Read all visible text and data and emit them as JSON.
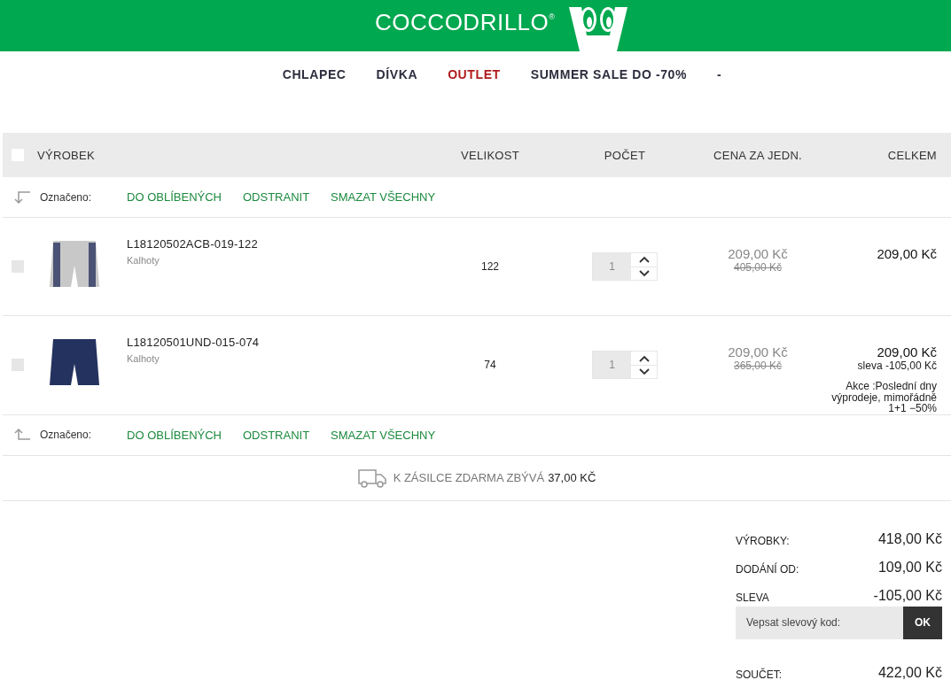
{
  "header": {
    "logo_text": "COCCODRILLO",
    "logo_mark": "®"
  },
  "nav": [
    {
      "label": "CHLAPEC",
      "highlighted": false
    },
    {
      "label": "DÍVKA",
      "highlighted": false
    },
    {
      "label": "OUTLET",
      "highlighted": true
    },
    {
      "label": "SUMMER SALE DO -70%",
      "highlighted": false
    },
    {
      "label": "-",
      "highlighted": false
    }
  ],
  "table": {
    "select_all": {
      "checked": false
    },
    "columns": [
      "VÝROBEK",
      "VELIKOST",
      "POČET",
      "CENA ZA JEDN.",
      "CELKEM"
    ],
    "bulk_actions_top": {
      "label": "Označeno:",
      "actions": [
        "DO OBLÍBENÝCH",
        "ODSTRANIT",
        "SMAZAT VŠECHNY"
      ]
    },
    "rows": [
      {
        "checked": false,
        "code": "L18120502ACB-019-122",
        "category": "Kalhoty",
        "kind": "striped",
        "size": "122",
        "quantity": "1",
        "price": "209,00 Kč",
        "old_price": "405,00 Kč",
        "total": "209,00 Kč"
      },
      {
        "checked": false,
        "code": "L18120501UND-015-074",
        "category": "Kalhoty",
        "kind": "plain",
        "size": "74",
        "quantity": "1",
        "price": "209,00 Kč",
        "old_price": "365,00 Kč",
        "total": "209,00 Kč",
        "discount": "sleva -105,00 Kč",
        "promo": "Akce :Poslední dny výprodeje, mimořádně 1+1 −50%"
      }
    ],
    "bulk_actions_bottom": {
      "label": "Označeno:",
      "actions": [
        "DO OBLÍBENÝCH",
        "ODSTRANIT",
        "SMAZAT VŠECHNY"
      ]
    }
  },
  "shipping": {
    "text": "K ZÁSILCE ZDARMA ZBÝVÁ",
    "amount": "37,00 KČ"
  },
  "summary": {
    "lines": [
      {
        "label": "VÝROBKY:",
        "value": "418,00 Kč"
      },
      {
        "label": "DODÁNÍ OD:",
        "value": "109,00 Kč"
      },
      {
        "label": "SLEVA",
        "value": "-105,00 Kč"
      }
    ],
    "coupon": {
      "placeholder": "Vepsat slevový kod:",
      "button": "OK"
    },
    "total": {
      "label": "SOUČET:",
      "value": "422,00 Kč"
    }
  }
}
